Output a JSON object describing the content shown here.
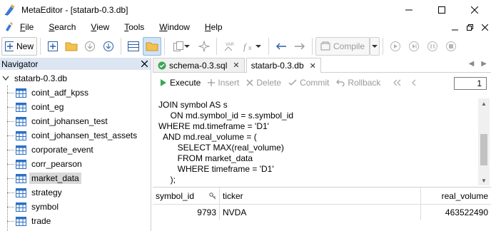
{
  "window": {
    "title": "MetaEditor - [statarb-0.3.db]",
    "icon": "metaeditor-icon"
  },
  "menu": {
    "items": [
      {
        "label": "File",
        "access": "F",
        "rest": "ile"
      },
      {
        "label": "Search",
        "access": "S",
        "rest": "earch"
      },
      {
        "label": "View",
        "access": "V",
        "rest": "iew"
      },
      {
        "label": "Tools",
        "access": "T",
        "rest": "ools"
      },
      {
        "label": "Window",
        "access": "W",
        "rest": "indow"
      },
      {
        "label": "Help",
        "access": "H",
        "rest": "elp"
      }
    ]
  },
  "toolbar": {
    "new_label": "New",
    "compile_label": "Compile"
  },
  "navigator": {
    "title": "Navigator",
    "root": "statarb-0.3.db",
    "items": [
      "coint_adf_kpss",
      "coint_eg",
      "coint_johansen_test",
      "coint_johansen_test_assets",
      "corporate_event",
      "corr_pearson",
      "market_data",
      "strategy",
      "symbol",
      "trade"
    ],
    "selected": "market_data"
  },
  "tabs": [
    {
      "label": "schema-0.3.sql",
      "active": false
    },
    {
      "label": "statarb-0.3.db",
      "active": true
    }
  ],
  "editor_toolbar": {
    "execute": "Execute",
    "insert": "Insert",
    "delete": "Delete",
    "commit": "Commit",
    "rollback": "Rollback",
    "page": "1"
  },
  "sql_lines": [
    "JOIN symbol AS s",
    "     ON md.symbol_id = s.symbol_id",
    "WHERE md.timeframe = 'D1'",
    "  AND md.real_volume = (",
    "        SELECT MAX(real_volume)",
    "        FROM market_data",
    "        WHERE timeframe = 'D1'",
    "     );"
  ],
  "results": {
    "columns": [
      "symbol_id",
      "ticker",
      "real_volume"
    ],
    "rows": [
      [
        "9793",
        "NVDA",
        "463522490"
      ]
    ]
  },
  "colors": {
    "accent": "#cfe3f7",
    "nav_header": "#dbe6f2",
    "selected_row": "#d9d9d9"
  }
}
